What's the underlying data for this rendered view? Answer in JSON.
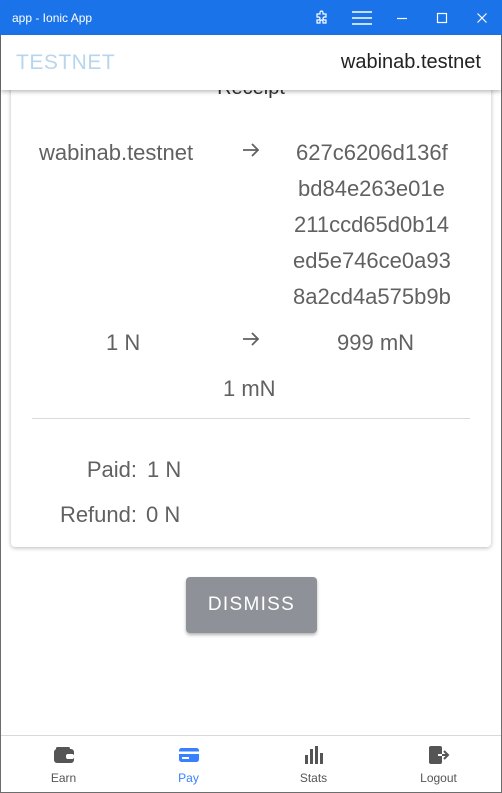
{
  "window": {
    "title": "app - Ionic App"
  },
  "header": {
    "brand": "TESTNET",
    "account": "wabinab.testnet"
  },
  "receipt": {
    "title": "Receipt",
    "from": "wabinab.testnet",
    "to_lines": [
      "627c6206d136f",
      "bd84e263e01e",
      "211ccd65d0b14",
      "ed5e746ce0a93",
      "8a2cd4a575b9b"
    ],
    "amount_sent": "1 N",
    "amount_received": "999 mN",
    "fee": "1 mN",
    "paid_label": "Paid:",
    "paid_value": "1 N",
    "refund_label": "Refund:",
    "refund_value": "0 N"
  },
  "dismiss_label": "DISMISS",
  "tabs": [
    {
      "label": "Earn",
      "icon": "wallet-icon",
      "active": false
    },
    {
      "label": "Pay",
      "icon": "card-icon",
      "active": true
    },
    {
      "label": "Stats",
      "icon": "stats-icon",
      "active": false
    },
    {
      "label": "Logout",
      "icon": "logout-icon",
      "active": false
    }
  ],
  "colors": {
    "titlebar": "#1a73e8",
    "brand": "#b7d6ee",
    "active_tab": "#3880ff",
    "dismiss": "#8e9197"
  }
}
